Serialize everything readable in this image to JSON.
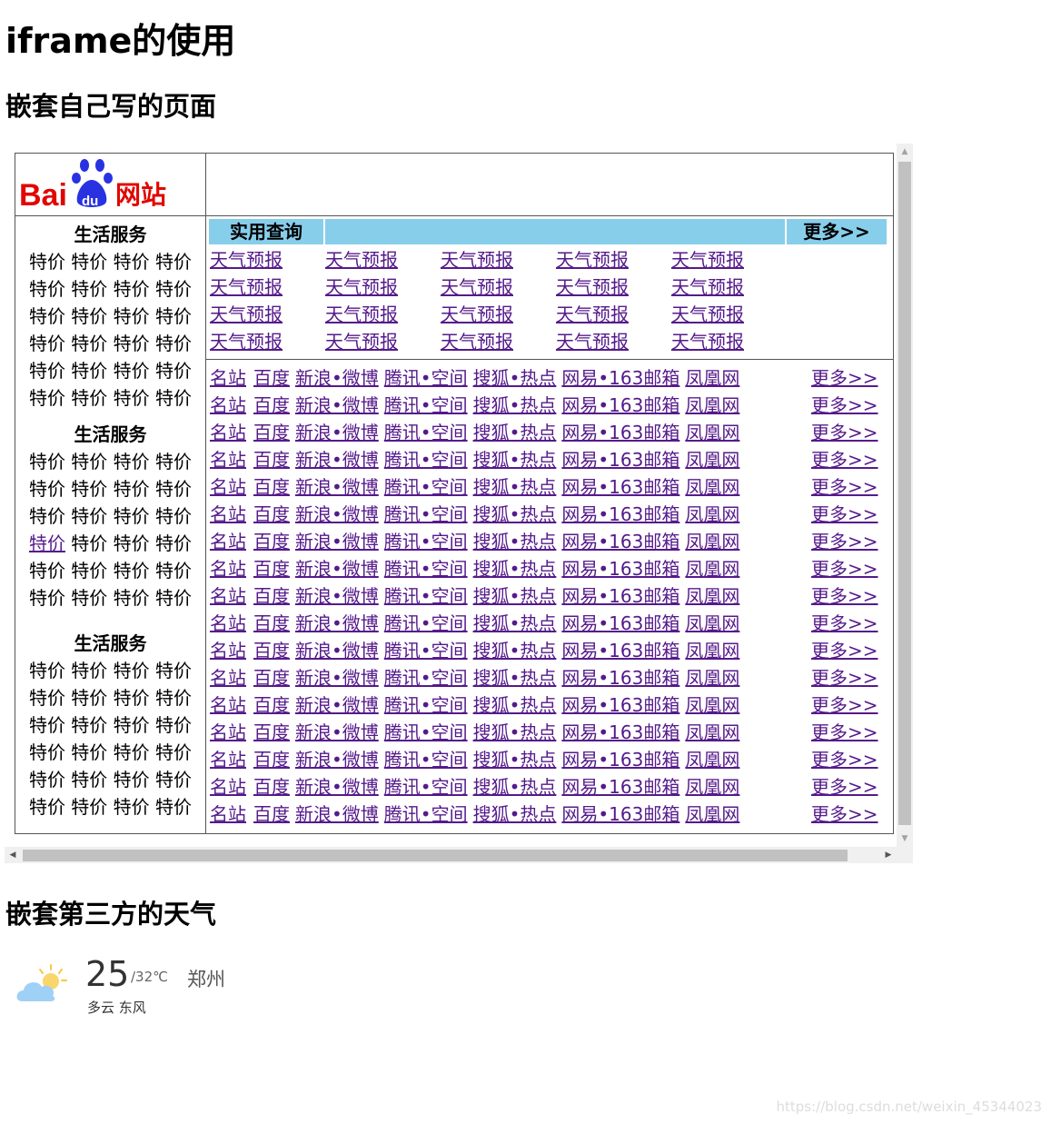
{
  "page": {
    "title": "iframe的使用",
    "section1": "嵌套自己写的页面",
    "section2": "嵌套第三方的天气",
    "watermark": "https://blog.csdn.net/weixin_45344023"
  },
  "inner": {
    "logo_text": "Bai",
    "logo_du": "du",
    "logo_cn": "网站",
    "services": [
      {
        "title": "生活服务",
        "rows": [
          "特价 特价 特价 特价",
          "特价 特价 特价 特价",
          "特价 特价 特价 特价",
          "特价 特价 特价 特价",
          "特价 特价 特价 特价",
          "特价 特价 特价 特价"
        ]
      },
      {
        "title": "生活服务",
        "rows": [
          "特价 特价 特价 特价",
          "特价 特价 特价 特价",
          "特价 特价 特价 特价",
          "特价 特价 特价 特价",
          "特价 特价 特价 特价",
          "特价 特价 特价 特价"
        ]
      },
      {
        "title": "生活服务",
        "rows": [
          "特价 特价 特价 特价",
          "特价 特价 特价 特价",
          "特价 特价 特价 特价",
          "特价 特价 特价 特价",
          "特价 特价 特价 特价",
          "特价 特价 特价 特价"
        ]
      }
    ],
    "query_title": "实用查询",
    "query_more": "更多>>",
    "weather_link": "天气预报",
    "link_row": {
      "label": "名站",
      "links": [
        "百度",
        "新浪•微博",
        "腾讯•空间",
        "搜狐•热点",
        "网易•163邮箱",
        "凤凰网"
      ],
      "more": "更多>>"
    }
  },
  "weather": {
    "temp": "25",
    "range": "/32℃",
    "city": "郑州",
    "desc": "多云 东风",
    "icon": "partly-cloudy-icon"
  }
}
